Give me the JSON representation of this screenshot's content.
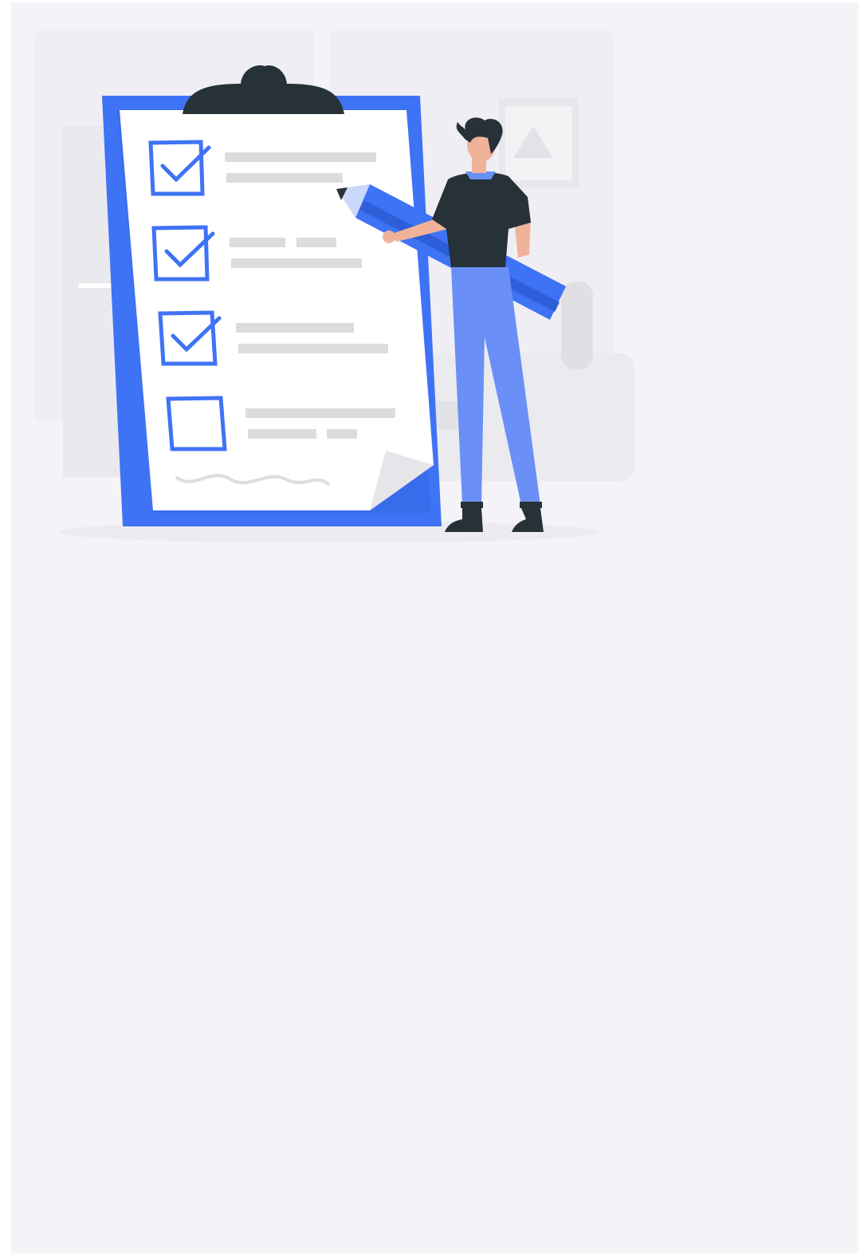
{
  "screen": {
    "background_color": "#f4f4f8"
  },
  "illustration": {
    "icon": "checklist-illustration-icon",
    "accent_color": "#3f73f5",
    "dark_color": "#263238",
    "checklist": {
      "items": [
        {
          "checked": true
        },
        {
          "checked": true
        },
        {
          "checked": true
        },
        {
          "checked": false
        }
      ]
    }
  }
}
